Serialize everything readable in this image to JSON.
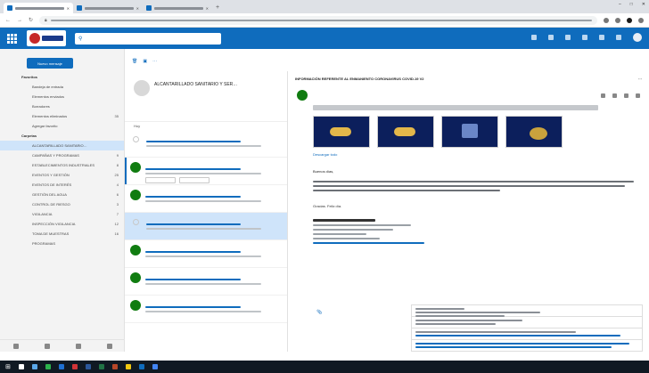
{
  "browser": {
    "tabs": [
      {
        "active": true
      },
      {
        "active": false
      },
      {
        "active": false
      }
    ],
    "tab_add": "+",
    "window_controls": [
      "–",
      "□",
      "✕"
    ]
  },
  "outlook": {
    "search_icon": "search-icon",
    "new_message_label": "Nuevo mensaje",
    "brand_color": "#0f6cbd"
  },
  "folders": [
    {
      "label": "Favoritos",
      "group": true
    },
    {
      "label": "Bandeja de entrada",
      "count": ""
    },
    {
      "label": "Elementos enviados",
      "count": ""
    },
    {
      "label": "Borradores",
      "count": ""
    },
    {
      "label": "Elementos eliminados",
      "count": "35"
    },
    {
      "label": "Agregar favorito",
      "count": ""
    },
    {
      "label": "Carpetas",
      "group": true
    },
    {
      "label": "ALCANTARILLADO SANITARIO…",
      "count": "",
      "selected": true
    },
    {
      "label": "CAMPAÑAS Y PROGRAMAS",
      "count": "9"
    },
    {
      "label": "ESTABLECIMIENTOS INDUSTRIALES",
      "count": "8"
    },
    {
      "label": "EVENTOS Y GESTIÓN",
      "count": "25"
    },
    {
      "label": "EVENTOS DE INTERÉS",
      "count": "4"
    },
    {
      "label": "GESTIÓN DEL AGUA",
      "count": "6"
    },
    {
      "label": "CONTROL DE RIESGO",
      "count": "3"
    },
    {
      "label": "VIGILANCIA",
      "count": "7"
    },
    {
      "label": "INSPECCIÓN VIGILANCIA",
      "count": "12"
    },
    {
      "label": "TOMA DE MUESTRAS",
      "count": "16"
    },
    {
      "label": "PROGRAMAS",
      "count": ""
    }
  ],
  "list": {
    "title": "ALCANTARILLADO SANITARIO Y SER…",
    "section": "Hoy",
    "items": [
      {
        "from": "",
        "date": "",
        "avatar": false,
        "unread": false,
        "selected": false,
        "attachments": false
      },
      {
        "from": "",
        "date": "",
        "avatar": true,
        "unread": true,
        "selected": false,
        "attachments": true
      },
      {
        "from": "",
        "date": "",
        "avatar": true,
        "unread": false,
        "selected": false,
        "attachments": false
      },
      {
        "from": "",
        "date": "",
        "avatar": false,
        "unread": false,
        "selected": true,
        "attachments": false
      },
      {
        "from": "",
        "date": "",
        "avatar": true,
        "unread": false,
        "selected": false,
        "attachments": false
      },
      {
        "from": "",
        "date": "",
        "avatar": true,
        "unread": false,
        "selected": false,
        "attachments": false
      },
      {
        "from": "",
        "date": "",
        "avatar": true,
        "unread": false,
        "selected": false,
        "attachments": false
      }
    ]
  },
  "reading": {
    "subject": "INFORMACIÓN REFERENTE AL ENMANIENTO CORONAVIRUS COVID-19 V2",
    "sender": "",
    "greeting": "Buenos días,",
    "thanks": "Gracias. Feliz día.",
    "signature_name": "",
    "download_label": "Descargar todo"
  },
  "taskbar": {
    "start_icon": "windows-start-icon"
  }
}
